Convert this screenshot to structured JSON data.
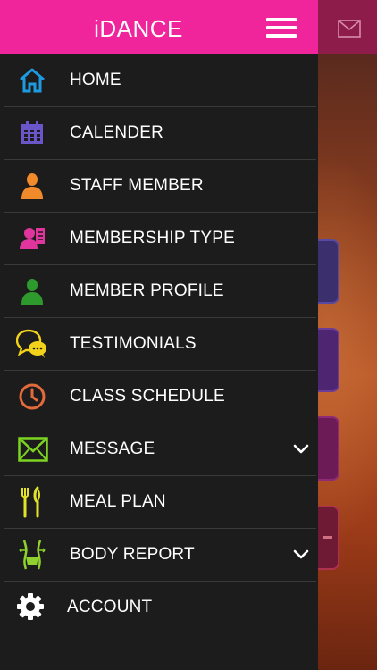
{
  "app": {
    "title": "iDANCE"
  },
  "menu": {
    "items": [
      {
        "label": "HOME",
        "icon": "home-icon"
      },
      {
        "label": "CALENDER",
        "icon": "calendar-icon"
      },
      {
        "label": "STAFF MEMBER",
        "icon": "staff-member-icon"
      },
      {
        "label": "MEMBERSHIP TYPE",
        "icon": "membership-type-icon"
      },
      {
        "label": "MEMBER PROFILE",
        "icon": "member-profile-icon"
      },
      {
        "label": "TESTIMONIALS",
        "icon": "testimonials-chat-icon"
      },
      {
        "label": "CLASS SCHEDULE",
        "icon": "clock-icon"
      },
      {
        "label": "MESSAGE",
        "icon": "envelope-icon",
        "expandable": true
      },
      {
        "label": "MEAL PLAN",
        "icon": "fork-knife-icon"
      },
      {
        "label": "BODY REPORT",
        "icon": "body-icon",
        "expandable": true
      },
      {
        "label": "ACCOUNT",
        "icon": "gear-icon"
      }
    ]
  },
  "colors": {
    "header": "#f0259b",
    "drawer_bg": "#1c1c1c",
    "home": "#1e9be0",
    "calendar": "#6a55c9",
    "staff": "#f08a2a",
    "membership": "#e0359c",
    "profile": "#2e9a2e",
    "testimonials": "#f2d21a",
    "schedule": "#e36a3a",
    "message": "#7dd321",
    "meal": "#e2e22a",
    "body": "#8fd12e"
  }
}
